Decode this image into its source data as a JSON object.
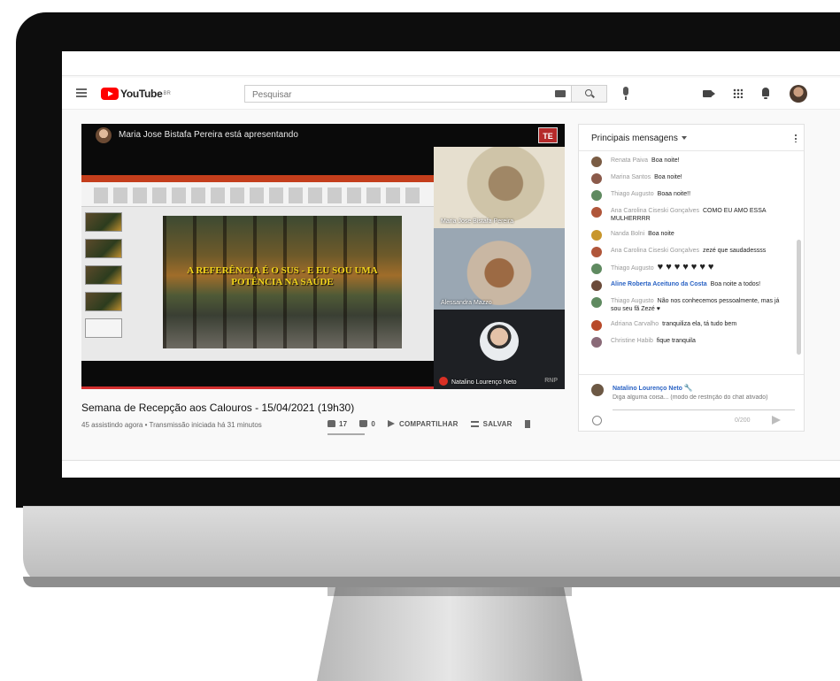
{
  "header": {
    "logo_text": "YouTube",
    "logo_sup": "BR",
    "search_placeholder": "Pesquisar"
  },
  "player": {
    "presenter_text": "Maria Jose Bistafa Pereira está apresentando",
    "badge": "TE",
    "slide_title": "A REFERÊNCIA É O SUS - E EU SOU UMA POTÊNCIA NA SAÚDE",
    "participants": [
      {
        "name": "Maria Jose Bistafa Pereira"
      },
      {
        "name": "Alessandra Mazzo"
      },
      {
        "name": "Natalino Lourenço Neto"
      }
    ],
    "tile_badge": "RNP"
  },
  "video": {
    "title": "Semana de Recepção aos Calouros - 15/04/2021 (19h30)",
    "meta": "45 assistindo agora • Transmissão iniciada há 31 minutos",
    "likes": "17",
    "dislikes": "0",
    "share_label": "COMPARTILHAR",
    "save_label": "SALVAR"
  },
  "chat": {
    "title": "Principais mensagens",
    "messages": [
      {
        "author": "Renata Paiva",
        "text": "Boa noite!",
        "avatar_color": "#7a5c44"
      },
      {
        "author": "Marina Santos",
        "text": "Boa noite!",
        "avatar_color": "#8b5a4a"
      },
      {
        "author": "Thiago Augusto",
        "text": "Boaa noite!!",
        "avatar_color": "#5f8a60"
      },
      {
        "author": "Ana Carolina Ciseski Gonçalves",
        "text": "COMO EU AMO ESSA MULHERRRR",
        "avatar_color": "#b0563a"
      },
      {
        "author": "Nanda Bolni",
        "text": "Boa noite",
        "avatar_color": "#c8962c"
      },
      {
        "author": "Ana Carolina Ciseski Gonçalves",
        "text": "zezé que saudadessss",
        "avatar_color": "#b0563a"
      },
      {
        "author": "Thiago Augusto",
        "text": "♥♥♥♥♥♥♥",
        "avatar_color": "#5f8a60"
      },
      {
        "author": "Aline Roberta Aceituno da Costa",
        "text": "Boa noite a todos!",
        "avatar_color": "#6b4b3a"
      },
      {
        "author": "Thiago Augusto",
        "text": "Não nos conhecemos pessoalmente, mas já sou seu fã Zezé ♥",
        "avatar_color": "#5f8a60"
      },
      {
        "author": "Adriana Carvalho",
        "text": "tranquiliza ela, tá tudo bem",
        "avatar_color": "#b84a2a"
      },
      {
        "author": "Christine Habib",
        "text": "fique tranquila",
        "avatar_color": "#8a6a78"
      }
    ],
    "input": {
      "user": "Natalino Lourenço Neto",
      "placeholder": "Diga alguma coisa... (modo de restrição do chat ativado)",
      "counter": "0/200"
    }
  }
}
